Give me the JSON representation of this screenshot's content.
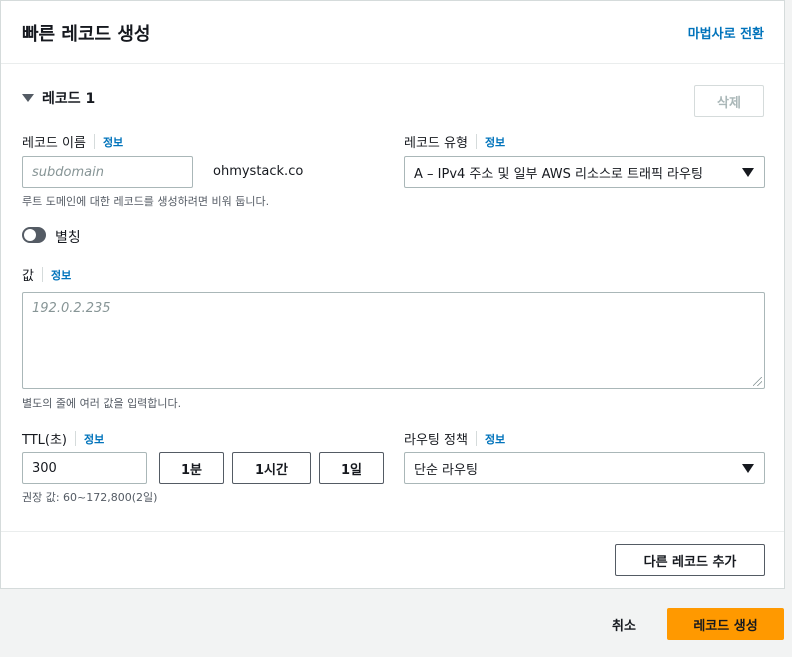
{
  "header": {
    "title": "빠른 레코드 생성",
    "wizard_link": "마법사로 전환"
  },
  "record": {
    "heading": "레코드 1",
    "delete_label": "삭제",
    "name": {
      "label": "레코드 이름",
      "info": "정보",
      "placeholder": "subdomain",
      "domain_suffix": "ohmystack.co",
      "hint": "루트 도메인에 대한 레코드를 생성하려면 비워 둡니다."
    },
    "type": {
      "label": "레코드 유형",
      "info": "정보",
      "selected": "A – IPv4 주소 및 일부 AWS 리소스로 트래픽 라우팅"
    },
    "alias": {
      "label": "별칭",
      "enabled": false
    },
    "value": {
      "label": "값",
      "info": "정보",
      "placeholder": "192.0.2.235",
      "hint": "별도의 줄에 여러 값을 입력합니다."
    },
    "ttl": {
      "label": "TTL(초)",
      "info": "정보",
      "value": "300",
      "presets": [
        "1분",
        "1시간",
        "1일"
      ],
      "hint": "권장 값: 60~172,800(2일)"
    },
    "routing": {
      "label": "라우팅 정책",
      "info": "정보",
      "selected": "단순 라우팅"
    }
  },
  "add_record_label": "다른 레코드 추가",
  "footer": {
    "cancel_label": "취소",
    "create_label": "레코드 생성"
  },
  "colors": {
    "accent": "#ff9900",
    "link": "#0073bb"
  }
}
